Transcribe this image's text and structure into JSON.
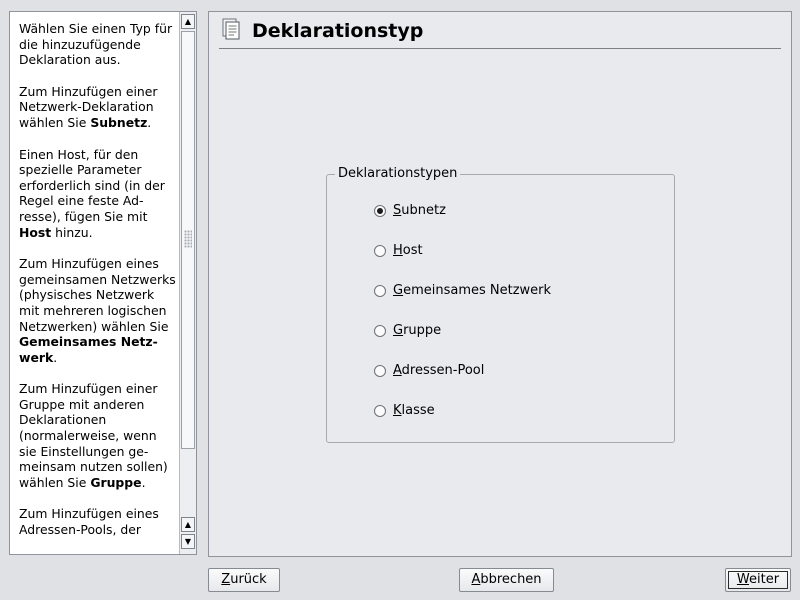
{
  "help": {
    "paragraphs": [
      [
        {
          "t": "Wählen Sie einen Typ für die hinzuzufügende Deklaration aus."
        }
      ],
      [
        {
          "t": "Zum Hinzufügen einer Netzwerk-Deklaration wählen Sie "
        },
        {
          "t": "Subnetz",
          "b": true
        },
        {
          "t": "."
        }
      ],
      [
        {
          "t": "Einen Host, für den spezielle Parameter erforderlich sind (in der Regel eine feste Ad-resse), fügen Sie mit "
        },
        {
          "t": "Host",
          "b": true
        },
        {
          "t": " hinzu."
        }
      ],
      [
        {
          "t": "Zum Hinzufügen eines gemeinsamen Netzwerks (physisches Netzwerk mit mehreren logischen Netzwerken) wählen Sie "
        },
        {
          "t": "Gemeinsames Netz-werk",
          "b": true
        },
        {
          "t": "."
        }
      ],
      [
        {
          "t": "Zum Hinzufügen einer Gruppe mit anderen Deklarationen (normalerweise, wenn sie Einstellungen ge-meinsam nutzen sollen) wählen Sie "
        },
        {
          "t": "Gruppe",
          "b": true
        },
        {
          "t": "."
        }
      ],
      [
        {
          "t": "Zum Hinzufügen eines Adressen-Pools, der"
        }
      ]
    ]
  },
  "header": {
    "title": "Deklarationstyp",
    "icon": "document-list-icon"
  },
  "group": {
    "title": "Deklarationstypen",
    "options": [
      {
        "mnemonic": "S",
        "rest": "ubnetz",
        "checked": true
      },
      {
        "mnemonic": "H",
        "rest": "ost",
        "checked": false
      },
      {
        "mnemonic": "G",
        "rest": "emeinsames Netzwerk",
        "checked": false
      },
      {
        "mnemonic": "G",
        "rest": "ruppe",
        "checked": false
      },
      {
        "mnemonic": "A",
        "rest": "dressen-Pool",
        "checked": false
      },
      {
        "mnemonic": "K",
        "rest": "lasse",
        "checked": false
      }
    ]
  },
  "buttons": {
    "back": {
      "mnemonic": "Z",
      "rest": "urück"
    },
    "abort": {
      "mnemonic": "A",
      "rest": "bbrechen"
    },
    "next": {
      "mnemonic": "W",
      "rest": "eiter"
    }
  }
}
